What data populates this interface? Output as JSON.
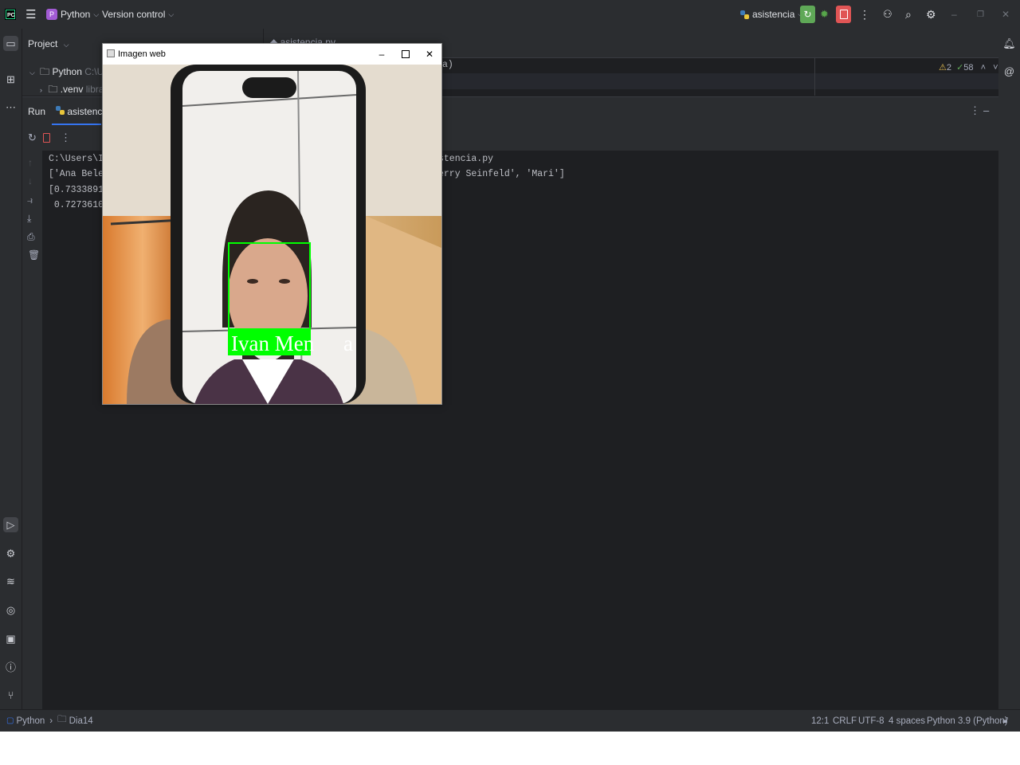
{
  "titlebar": {
    "project_badge": "P",
    "project_name": "Python",
    "vcs_label": "Version control",
    "run_config": "asistencia"
  },
  "project_panel": {
    "title": "Project",
    "tree": [
      {
        "name": "Python",
        "hint": "C:\\User"
      },
      {
        "name": ".venv",
        "hint": "library"
      }
    ]
  },
  "editor": {
    "tab": "asistencia.py",
    "partial_line": "a)",
    "inspections": {
      "warnings": "2",
      "ok": "58"
    }
  },
  "run_panel": {
    "label": "Run",
    "tab": "asistencia",
    "console_left": [
      "C:\\Users\\Ivar",
      "['Ana Belen',",
      "[0.73338912 (",
      " 0.72736109 ("
    ],
    "console_right": [
      "stencia.py",
      "erry Seinfeld', 'Mari']"
    ]
  },
  "cv_window": {
    "title": "Imagen web",
    "label_on_box": "Ivan Men",
    "label_overflow": "a"
  },
  "statusbar": {
    "crumbs": [
      "Python",
      "Dia14"
    ],
    "position": "12:1",
    "line_sep": "CRLF",
    "encoding": "UTF-8",
    "indent": "4 spaces",
    "interpreter": "Python 3.9 (Python)"
  },
  "colors": {
    "accent_green": "#00ff00",
    "run_green": "#5fa857",
    "stop_red": "#e05555",
    "project_badge": "#a25bd4"
  }
}
